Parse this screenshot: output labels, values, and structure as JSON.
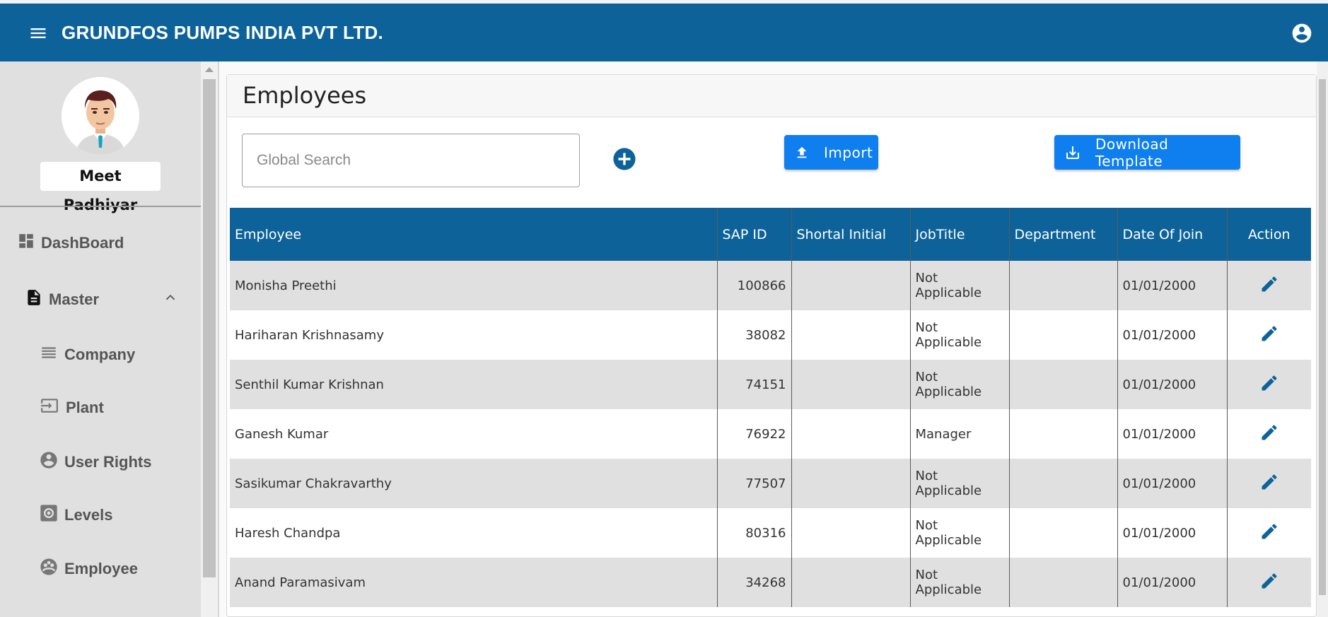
{
  "header": {
    "title": "GRUNDFOS PUMPS INDIA PVT LTD.",
    "menu_icon": "hamburger-menu-icon",
    "account_icon": "account-circle-icon"
  },
  "sidebar": {
    "user_name": "Meet Padhiyar",
    "items": [
      {
        "label": "DashBoard",
        "icon": "dashboard-icon"
      },
      {
        "label": "Master",
        "icon": "document-icon"
      },
      {
        "label": "Company",
        "icon": "list-icon"
      },
      {
        "label": "Plant",
        "icon": "input-icon"
      },
      {
        "label": "User Rights",
        "icon": "user-circle-icon"
      },
      {
        "label": "Levels",
        "icon": "settings-box-icon"
      },
      {
        "label": "Employee",
        "icon": "group-icon"
      }
    ]
  },
  "page": {
    "title": "Employees"
  },
  "search": {
    "placeholder": "Global Search",
    "value": ""
  },
  "buttons": {
    "import": "Import",
    "download": "Download Template"
  },
  "table": {
    "headers": [
      "Employee",
      "SAP ID",
      "Shortal Initial",
      "JobTitle",
      "Department",
      "Date Of Join",
      "Action"
    ],
    "rows": [
      {
        "employee": "Monisha Preethi",
        "sap_id": "100866",
        "initial": "",
        "job": "Not Applicable",
        "dept": "",
        "doj": "01/01/2000"
      },
      {
        "employee": "Hariharan Krishnasamy",
        "sap_id": "38082",
        "initial": "",
        "job": "Not Applicable",
        "dept": "",
        "doj": "01/01/2000"
      },
      {
        "employee": "Senthil Kumar Krishnan",
        "sap_id": "74151",
        "initial": "",
        "job": "Not Applicable",
        "dept": "",
        "doj": "01/01/2000"
      },
      {
        "employee": "Ganesh Kumar",
        "sap_id": "76922",
        "initial": "",
        "job": "Manager",
        "dept": "",
        "doj": "01/01/2000"
      },
      {
        "employee": "Sasikumar Chakravarthy",
        "sap_id": "77507",
        "initial": "",
        "job": "Not Applicable",
        "dept": "",
        "doj": "01/01/2000"
      },
      {
        "employee": "Haresh Chandpa",
        "sap_id": "80316",
        "initial": "",
        "job": "Not Applicable",
        "dept": "",
        "doj": "01/01/2000"
      },
      {
        "employee": "Anand Paramasivam",
        "sap_id": "34268",
        "initial": "",
        "job": "Not Applicable",
        "dept": "",
        "doj": "01/01/2000"
      }
    ]
  },
  "colors": {
    "primary": "#0d6399",
    "button": "#0f7ff0",
    "row_alt": "#e0e0e0",
    "sidebar": "#e0e0e0"
  }
}
